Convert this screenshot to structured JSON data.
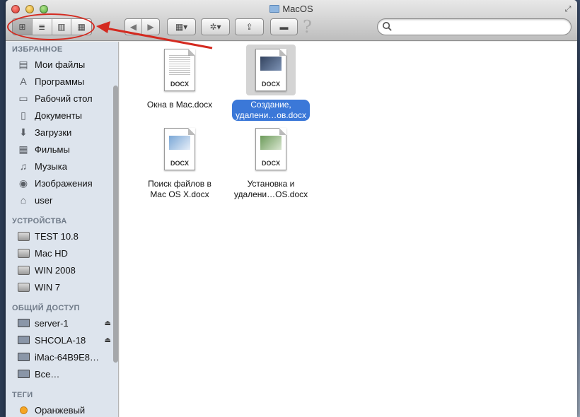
{
  "window": {
    "title": "MacOS"
  },
  "toolbar": {
    "view_buttons": [
      {
        "name": "icon-view",
        "glyph": "⊞",
        "active": true
      },
      {
        "name": "list-view",
        "glyph": "≣",
        "active": false
      },
      {
        "name": "column-view",
        "glyph": "▥",
        "active": false
      },
      {
        "name": "coverflow-view",
        "glyph": "▦",
        "active": false
      }
    ],
    "back_glyph": "◀",
    "forward_glyph": "▶",
    "arrange_glyph": "▦▾",
    "action_glyph": "✲▾",
    "share_glyph": "⇪",
    "label_glyph": "▬",
    "help_glyph": "?",
    "search_placeholder": ""
  },
  "sidebar": {
    "favorites_header": "ИЗБРАННОЕ",
    "favorites": [
      {
        "label": "Мои файлы",
        "icon": "all-files-icon",
        "glyph": "▤"
      },
      {
        "label": "Программы",
        "icon": "applications-icon",
        "glyph": "A"
      },
      {
        "label": "Рабочий стол",
        "icon": "desktop-icon",
        "glyph": "▭"
      },
      {
        "label": "Документы",
        "icon": "documents-icon",
        "glyph": "▯"
      },
      {
        "label": "Загрузки",
        "icon": "downloads-icon",
        "glyph": "⬇"
      },
      {
        "label": "Фильмы",
        "icon": "movies-icon",
        "glyph": "▦"
      },
      {
        "label": "Музыка",
        "icon": "music-icon",
        "glyph": "♫"
      },
      {
        "label": "Изображения",
        "icon": "pictures-icon",
        "glyph": "◉"
      },
      {
        "label": "user",
        "icon": "home-icon",
        "glyph": "⌂"
      }
    ],
    "devices_header": "УСТРОЙСТВА",
    "devices": [
      {
        "label": "TEST 10.8"
      },
      {
        "label": "Mac HD"
      },
      {
        "label": "WIN 2008"
      },
      {
        "label": "WIN 7"
      }
    ],
    "shared_header": "ОБЩИЙ ДОСТУП",
    "shared": [
      {
        "label": "server-1",
        "eject": "⏏"
      },
      {
        "label": "SHCOLA-18",
        "eject": "⏏"
      },
      {
        "label": "iMac-64B9E8…",
        "eject": ""
      },
      {
        "label": "Все…",
        "eject": ""
      }
    ],
    "tags_header": "ТЕГИ",
    "tags": [
      {
        "label": "Оранжевый",
        "color": "#f6a623"
      }
    ]
  },
  "files": [
    {
      "name_line1": "Окна в Mac.docx",
      "name_line2": "",
      "format": "DOCX",
      "selected": false,
      "thumb": "lines"
    },
    {
      "name_line1": "Создание,",
      "name_line2": "удалени…ов.docx",
      "format": "DOCX",
      "selected": true,
      "thumb": "dark"
    },
    {
      "name_line1": "Поиск файлов в",
      "name_line2": "Mac OS X.docx",
      "format": "DOCX",
      "selected": false,
      "thumb": "blue"
    },
    {
      "name_line1": "Установка и",
      "name_line2": "удалени…OS.docx",
      "format": "DOCX",
      "selected": false,
      "thumb": "green"
    }
  ],
  "colors": {
    "annotation": "#d42a20",
    "selection": "#3b78d8"
  }
}
